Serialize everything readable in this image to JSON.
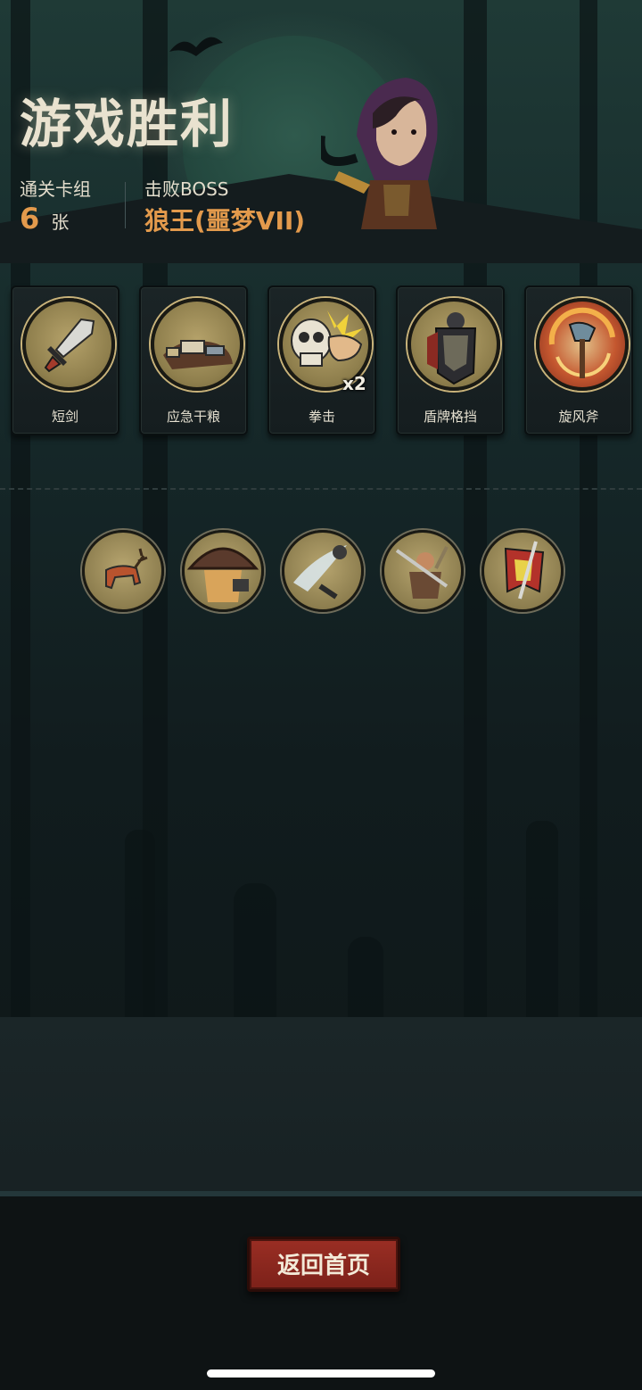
{
  "header": {
    "title": "游戏胜利",
    "deck_label": "通关卡组",
    "deck_count": "6",
    "deck_unit": "张",
    "boss_label": "击败BOSS",
    "boss_name": "狼王(噩梦VII)"
  },
  "cards": [
    {
      "label": "短剑",
      "icon": "short-sword-icon"
    },
    {
      "label": "应急干粮",
      "icon": "emergency-rations-icon"
    },
    {
      "label": "拳击",
      "icon": "punch-skull-icon",
      "badge": "x2"
    },
    {
      "label": "盾牌格挡",
      "icon": "shield-block-icon"
    },
    {
      "label": "旋风斧",
      "icon": "whirlwind-axe-icon"
    }
  ],
  "relics": [
    {
      "icon": "deer-relic-icon"
    },
    {
      "icon": "hat-relic-icon"
    },
    {
      "icon": "slash-relic-icon"
    },
    {
      "icon": "warrior-relic-icon"
    },
    {
      "icon": "banner-relic-icon"
    }
  ],
  "footer": {
    "home_button": "返回首页"
  },
  "colors": {
    "accent_orange": "#e39a4c",
    "button_red": "#8a271e",
    "background": "#111c1e"
  }
}
